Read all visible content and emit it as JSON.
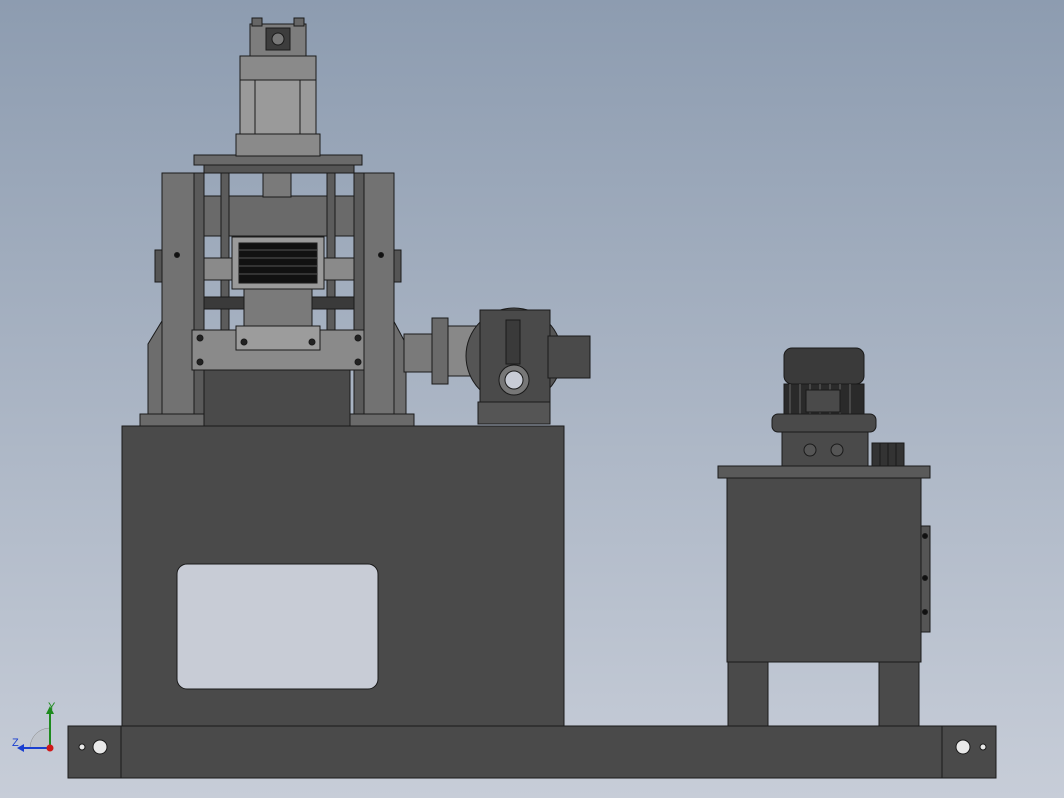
{
  "viewport": {
    "background_top": "#8d9cb0",
    "background_bottom": "#c7cdd8",
    "body_color": "#4a4a4a",
    "edge_color": "#1a1a1a",
    "light_part_color": "#6d6d6d"
  },
  "triad": {
    "y_label": "Y",
    "z_label": "Z",
    "x_color": "#d01818",
    "y_color": "#1e8a1e",
    "z_color": "#1a3fd0"
  }
}
